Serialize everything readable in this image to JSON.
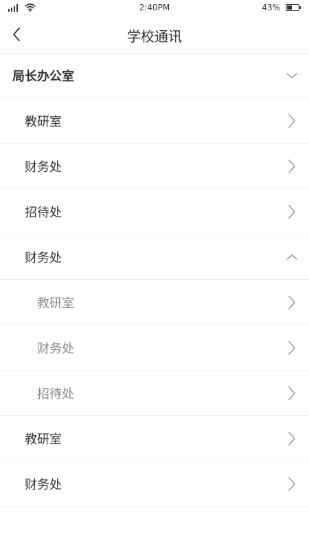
{
  "status_bar": {
    "time": "2:40PM",
    "battery_percent_text": "43%",
    "battery_level": 0.43
  },
  "nav": {
    "title": "学校通讯"
  },
  "list": {
    "rows": [
      {
        "label": "局长办公室",
        "level": 0,
        "icon": "chevron-down-icon"
      },
      {
        "label": "教研室",
        "level": 1,
        "icon": "chevron-right-icon"
      },
      {
        "label": "财务处",
        "level": 1,
        "icon": "chevron-right-icon"
      },
      {
        "label": "招待处",
        "level": 1,
        "icon": "chevron-right-icon"
      },
      {
        "label": "财务处",
        "level": 1,
        "icon": "chevron-up-icon"
      },
      {
        "label": "教研室",
        "level": 2,
        "icon": "chevron-right-icon"
      },
      {
        "label": "财务处",
        "level": 2,
        "icon": "chevron-right-icon"
      },
      {
        "label": "招待处",
        "level": 2,
        "icon": "chevron-right-icon"
      },
      {
        "label": "教研室",
        "level": 1,
        "icon": "chevron-right-icon"
      },
      {
        "label": "财务处",
        "level": 1,
        "icon": "chevron-right-icon"
      }
    ]
  }
}
